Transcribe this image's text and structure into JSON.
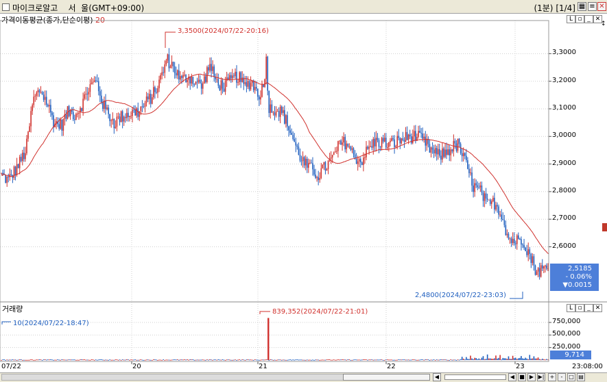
{
  "window": {
    "title": "마이크로알고    서  울(GMT+09:00)",
    "interval": "(1분)",
    "page": "[1/4]"
  },
  "price_panel": {
    "indicator_label": "가격이동평균(종가,단순이평)",
    "indicator_period": "20",
    "high_annotation": "3,3500(2024/07/22-20:16)",
    "low_annotation": "2,4800(2024/07/22-23:03)",
    "current_price": "2,5185",
    "change_pct": "- 0.06%",
    "change_value": "▼0.0015"
  },
  "volume_panel": {
    "label": "거래량",
    "min_annotation": "10(2024/07/22-18:47)",
    "max_annotation": "839,352(2024/07/22-21:01)",
    "current_volume": "9,714"
  },
  "x_axis": {
    "start_label": "07/22",
    "end_label": "23:08:00"
  },
  "colors": {
    "up": "#d0312d",
    "down": "#1f5fbf",
    "ma": "#d0312d",
    "badge": "#4d7fd9"
  },
  "chart_data": [
    {
      "type": "candlestick",
      "y_ticks": [
        2.6,
        2.7,
        2.8,
        2.9,
        3.0,
        3.1,
        3.2,
        3.3
      ],
      "y_tick_labels": [
        "2,6000",
        "2,7000",
        "2,8000",
        "2,9000",
        "3,0000",
        "3,1000",
        "3,2000",
        "3,3000"
      ],
      "ylim": [
        2.44,
        3.42
      ],
      "x_ticks": [
        "20",
        "21",
        "22",
        "23"
      ],
      "ma_period": 20,
      "close_anchors": [
        [
          0,
          2.86
        ],
        [
          10,
          2.84
        ],
        [
          25,
          2.9
        ],
        [
          35,
          2.95
        ],
        [
          45,
          3.13
        ],
        [
          55,
          3.17
        ],
        [
          65,
          3.12
        ],
        [
          75,
          3.05
        ],
        [
          85,
          3.04
        ],
        [
          95,
          3.09
        ],
        [
          105,
          3.08
        ],
        [
          115,
          3.12
        ],
        [
          125,
          3.18
        ],
        [
          135,
          3.2
        ],
        [
          145,
          3.11
        ],
        [
          160,
          3.05
        ],
        [
          175,
          3.08
        ],
        [
          195,
          3.09
        ],
        [
          205,
          3.12
        ],
        [
          215,
          3.15
        ],
        [
          225,
          3.2
        ],
        [
          235,
          3.28
        ],
        [
          245,
          3.25
        ],
        [
          255,
          3.2
        ],
        [
          265,
          3.22
        ],
        [
          275,
          3.2
        ],
        [
          285,
          3.18
        ],
        [
          295,
          3.26
        ],
        [
          305,
          3.2
        ],
        [
          315,
          3.18
        ],
        [
          325,
          3.2
        ],
        [
          335,
          3.22
        ],
        [
          345,
          3.18
        ],
        [
          355,
          3.2
        ],
        [
          365,
          3.15
        ],
        [
          372,
          3.18
        ],
        [
          376,
          3.28
        ],
        [
          380,
          3.1
        ],
        [
          390,
          3.1
        ],
        [
          400,
          3.08
        ],
        [
          410,
          3.02
        ],
        [
          420,
          2.95
        ],
        [
          430,
          2.9
        ],
        [
          440,
          2.88
        ],
        [
          450,
          2.86
        ],
        [
          460,
          2.89
        ],
        [
          470,
          2.92
        ],
        [
          480,
          2.97
        ],
        [
          490,
          2.98
        ],
        [
          500,
          2.93
        ],
        [
          510,
          2.91
        ],
        [
          520,
          2.95
        ],
        [
          530,
          2.98
        ],
        [
          540,
          2.98
        ],
        [
          550,
          2.97
        ],
        [
          560,
          2.98
        ],
        [
          570,
          2.99
        ],
        [
          580,
          3.0
        ],
        [
          590,
          3.0
        ],
        [
          600,
          2.98
        ],
        [
          610,
          2.95
        ],
        [
          620,
          2.93
        ],
        [
          630,
          2.94
        ],
        [
          640,
          2.96
        ],
        [
          648,
          2.97
        ],
        [
          655,
          2.93
        ],
        [
          662,
          2.88
        ],
        [
          670,
          2.82
        ],
        [
          680,
          2.8
        ],
        [
          690,
          2.75
        ],
        [
          700,
          2.76
        ],
        [
          710,
          2.72
        ],
        [
          720,
          2.63
        ],
        [
          730,
          2.62
        ],
        [
          740,
          2.63
        ],
        [
          750,
          2.57
        ],
        [
          760,
          2.51
        ],
        [
          770,
          2.52
        ],
        [
          777,
          2.52
        ]
      ]
    },
    {
      "type": "bar",
      "name": "거래량",
      "y_ticks": [
        250000,
        500000,
        750000
      ],
      "y_tick_labels": [
        "250,000",
        "500,000",
        "750,000"
      ],
      "ylim": [
        0,
        900000
      ],
      "spikes": [
        [
          379,
          839352
        ]
      ]
    }
  ]
}
